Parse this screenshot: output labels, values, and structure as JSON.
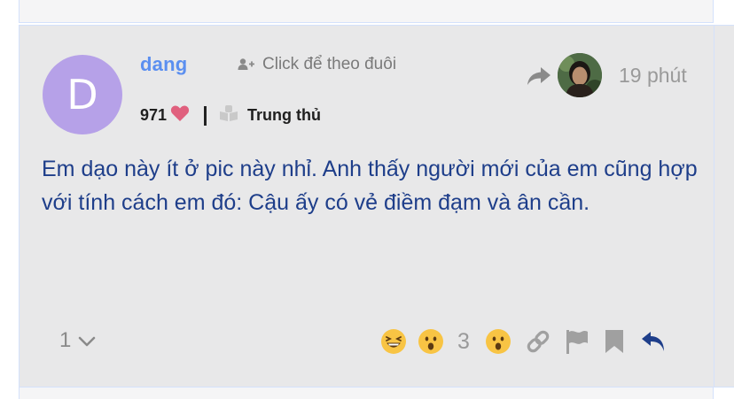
{
  "post": {
    "author": {
      "name": "dang",
      "initial": "D",
      "avatar_color": "#b6a1e8",
      "likes": "971",
      "rank": "Trung thủ"
    },
    "follow_label": "Click để theo đuôi",
    "time": "19 phút",
    "content": "Em dạo này ít ở pic này nhỉ. Anh thấy người mới của em cũng hợp với tính cách em đó: Cậu ấy có vẻ điềm đạm và ân cần.",
    "reply_count": "1",
    "reaction_count": "3"
  },
  "icons": {
    "follow": "add-user-icon",
    "like": "heart-icon",
    "rank": "book-icon",
    "share": "share-icon",
    "laugh": "laughing-emoji-icon",
    "wow": "surprised-emoji-icon",
    "link": "link-icon",
    "flag": "flag-icon",
    "bookmark": "bookmark-icon",
    "reply": "reply-icon",
    "expand": "chevron-down-icon"
  },
  "colors": {
    "username": "#5b8ff0",
    "content": "#1e3e8a",
    "heart": "#e0607e",
    "reply_icon": "#1e3e8a",
    "muted": "#9a9a9a",
    "post_bg": "#e8e8e9"
  }
}
